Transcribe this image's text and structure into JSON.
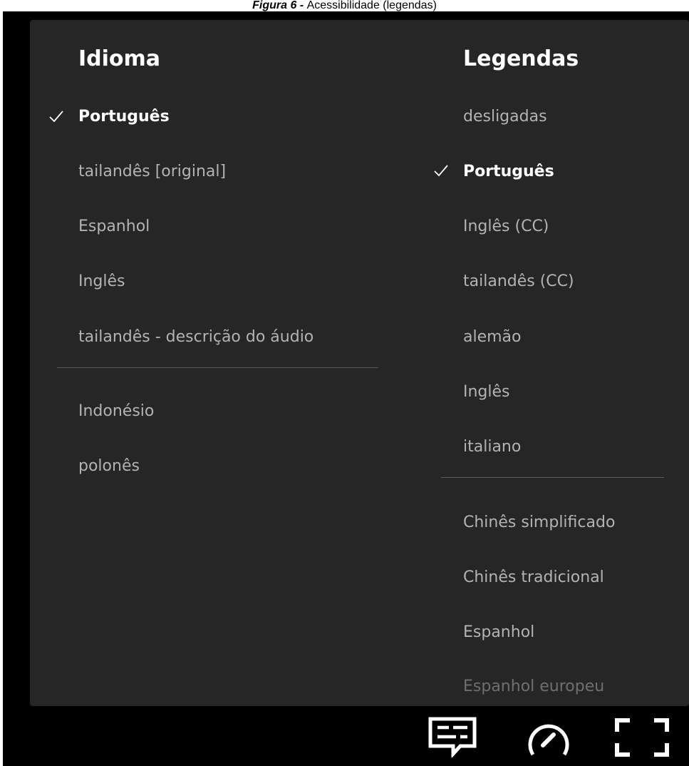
{
  "caption": {
    "prefix": "Figura 6 - ",
    "text": "Acessibilidade (legendas)"
  },
  "audio": {
    "title": "Idioma",
    "items": [
      {
        "label": "Português",
        "selected": true
      },
      {
        "label": "tailandês [original]"
      },
      {
        "label": "Espanhol"
      },
      {
        "label": "Inglês"
      },
      {
        "label": "tailandês - descrição do áudio"
      }
    ],
    "more_items": [
      {
        "label": "Indonésio"
      },
      {
        "label": "polonês"
      }
    ]
  },
  "subtitles": {
    "title": "Legendas",
    "items": [
      {
        "label": "desligadas"
      },
      {
        "label": "Português",
        "selected": true
      },
      {
        "label": "Inglês (CC)"
      },
      {
        "label": "tailandês (CC)"
      },
      {
        "label": "alemão"
      },
      {
        "label": "Inglês"
      },
      {
        "label": "italiano"
      }
    ],
    "more_items": [
      {
        "label": "Chinês simplificado"
      },
      {
        "label": "Chinês tradicional"
      },
      {
        "label": "Espanhol"
      },
      {
        "label": "Espanhol europeu"
      }
    ]
  },
  "controls": [
    {
      "icon": "subtitles-icon"
    },
    {
      "icon": "playback-speed-icon"
    },
    {
      "icon": "fullscreen-icon"
    }
  ],
  "colors": {
    "panel": "#262626",
    "background": "#000000",
    "selected_text": "#ffffff",
    "item_text": "#b3b3b3"
  }
}
